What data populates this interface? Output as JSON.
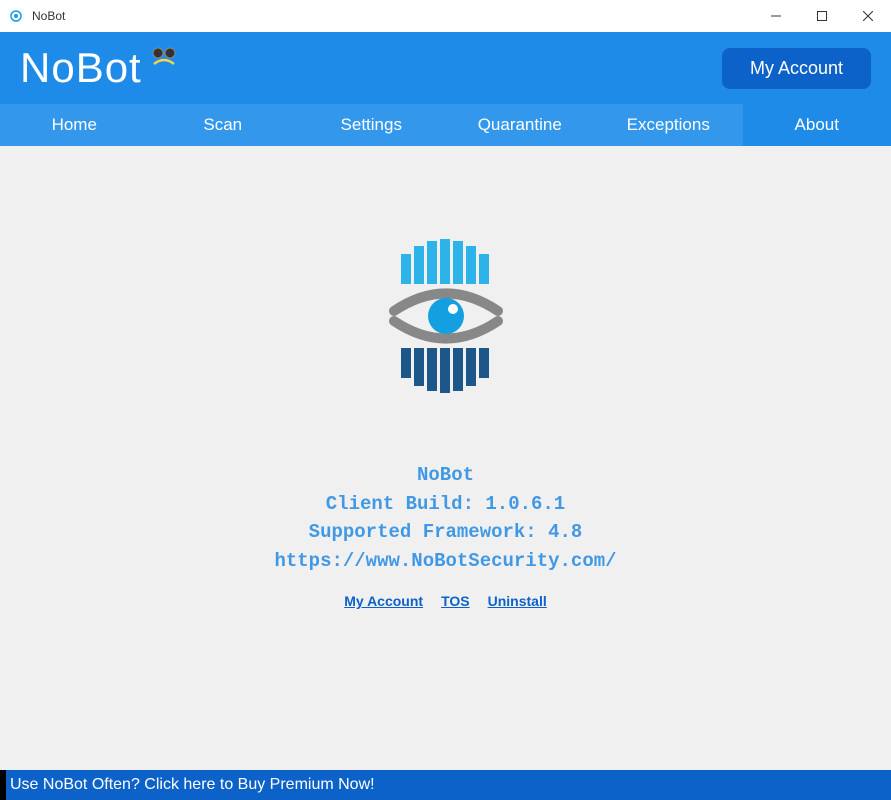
{
  "titlebar": {
    "title": "NoBot"
  },
  "header": {
    "logo": "NoBot",
    "my_account_label": "My Account"
  },
  "nav": {
    "items": [
      {
        "label": "Home"
      },
      {
        "label": "Scan"
      },
      {
        "label": "Settings"
      },
      {
        "label": "Quarantine"
      },
      {
        "label": "Exceptions"
      },
      {
        "label": "About"
      }
    ],
    "active_index": 5
  },
  "about": {
    "product_name": "NoBot",
    "client_build_label": "Client Build: 1.0.6.1",
    "framework_label": "Supported Framework: 4.8",
    "website": "https://www.NoBotSecurity.com/"
  },
  "links": {
    "my_account": "My Account",
    "tos": "TOS",
    "uninstall": "Uninstall"
  },
  "footer": {
    "promo": "Use NoBot Often? Click here to Buy Premium Now!"
  },
  "colors": {
    "header_blue": "#1f8be8",
    "nav_blue": "#3397ec",
    "dark_blue": "#0d62c9",
    "light_blue": "#4199e5"
  }
}
